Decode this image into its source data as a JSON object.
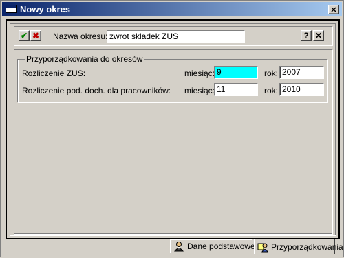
{
  "window": {
    "title": "Nowy okres",
    "close_glyph": "✕"
  },
  "header": {
    "confirm_glyph": "✔",
    "cancel_glyph": "✖",
    "name_label": "Nazwa okresu:",
    "name_value": "zwrot składek ZUS",
    "help_glyph": "?",
    "close_glyph": "✕"
  },
  "group": {
    "title": "Przyporządkowania do okresów",
    "rows": [
      {
        "label": "Rozliczenie ZUS:",
        "month_label": "miesiąc:",
        "month": "9",
        "year_label": "rok:",
        "year": "2007"
      },
      {
        "label": "Rozliczenie pod. doch. dla pracowników:",
        "month_label": "miesiąc:",
        "month": "11",
        "year_label": "rok:",
        "year": "2010"
      }
    ]
  },
  "tabs": [
    {
      "label": "Dane podstawowe",
      "icon": "person-icon"
    },
    {
      "label": "Przyporządkowania",
      "icon": "assignment-icon"
    }
  ],
  "colors": {
    "titlebar_start": "#0a246a",
    "titlebar_end": "#a6caf0",
    "focus_field": "#00ffff",
    "confirm": "#008000",
    "cancel": "#c00000"
  }
}
